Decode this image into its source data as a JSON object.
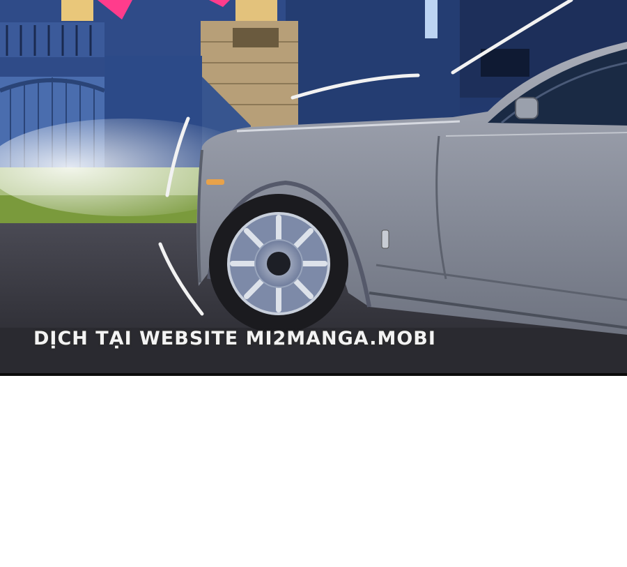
{
  "panel": {
    "watermark_text": "DỊCH TẠI WEBSITE MI2MANGA.MOBI",
    "colors": {
      "night_sky": "#1c2a4a",
      "house_wall": "#2e4a86",
      "warm_window": "#e8c77a",
      "car_body": "#8d93a1",
      "tire": "#1b1b1f",
      "road": "#34343c",
      "grass": "#6f8f3a",
      "accent_pink": "#ff3c8c"
    },
    "icons": [
      "car-illustration",
      "wheel-icon",
      "house-illustration"
    ]
  }
}
